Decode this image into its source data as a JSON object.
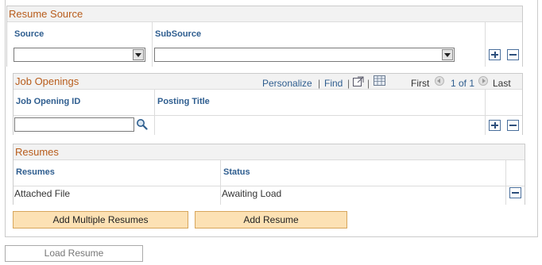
{
  "resume_source": {
    "title": "Resume Source",
    "columns": [
      "Source",
      "SubSource"
    ],
    "source_value": "",
    "subsource_value": ""
  },
  "job_openings": {
    "title": "Job Openings",
    "personalize": "Personalize",
    "find": "Find",
    "separator": "|",
    "first": "First",
    "range": "1 of 1",
    "last": "Last",
    "columns": [
      "Job Opening ID",
      "Posting Title"
    ],
    "job_opening_id_value": ""
  },
  "resumes": {
    "title": "Resumes",
    "columns": [
      "Resumes",
      "Status"
    ],
    "rows": [
      {
        "resume": "Attached File",
        "status": "Awaiting Load"
      }
    ]
  },
  "buttons": {
    "add_multiple": "Add Multiple Resumes",
    "add_resume": "Add Resume",
    "load_resume": "Load Resume"
  },
  "colors": {
    "section_title": "#b85c1b",
    "column_header": "#2e5d8f",
    "button_fill": "#fce1b4"
  }
}
